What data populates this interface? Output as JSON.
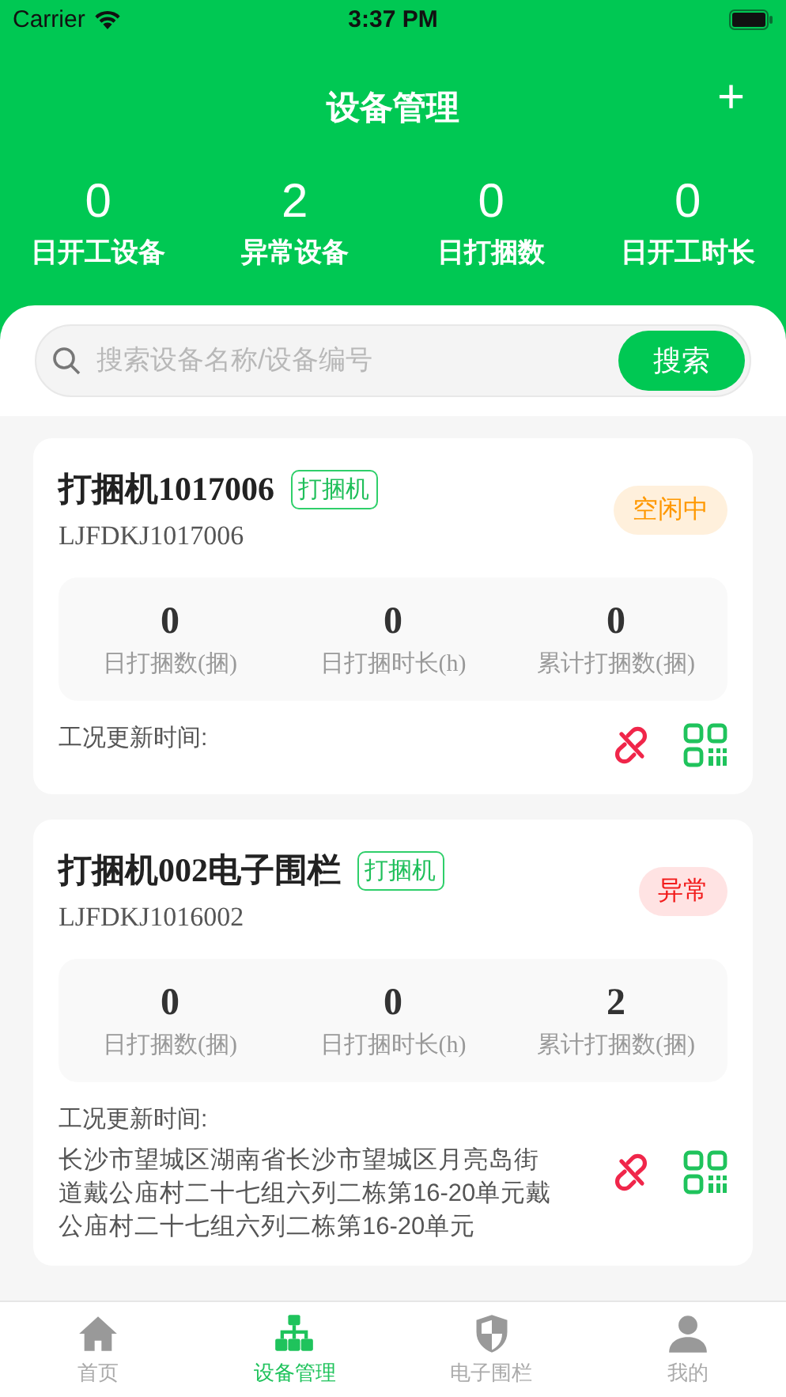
{
  "status_bar": {
    "carrier": "Carrier",
    "time": "3:37 PM"
  },
  "header": {
    "title": "设备管理",
    "add_label": "+"
  },
  "summary": [
    {
      "value": "0",
      "label": "日开工设备"
    },
    {
      "value": "2",
      "label": "异常设备"
    },
    {
      "value": "0",
      "label": "日打捆数"
    },
    {
      "value": "0",
      "label": "日开工时长"
    }
  ],
  "search": {
    "placeholder": "搜索设备名称/设备编号",
    "button": "搜索"
  },
  "devices": [
    {
      "name": "打捆机1017006",
      "tag": "打捆机",
      "code": "LJFDKJ1017006",
      "status": "空闲中",
      "kind": "idle",
      "stats": [
        {
          "value": "0",
          "label": "日打捆数(捆)"
        },
        {
          "value": "0",
          "label": "日打捆时长(h)"
        },
        {
          "value": "0",
          "label": "累计打捆数(捆)"
        }
      ],
      "update_label": "工况更新时间:"
    },
    {
      "name": "打捆机002电子围栏",
      "tag": "打捆机",
      "code": "LJFDKJ1016002",
      "status": "异常",
      "kind": "abnormal",
      "stats": [
        {
          "value": "0",
          "label": "日打捆数(捆)"
        },
        {
          "value": "0",
          "label": "日打捆时长(h)"
        },
        {
          "value": "2",
          "label": "累计打捆数(捆)"
        }
      ],
      "update_label": "工况更新时间:",
      "address": "长沙市望城区湖南省长沙市望城区月亮岛街道戴公庙村二十七组六列二栋第16-20单元戴公庙村二十七组六列二栋第16-20单元"
    }
  ],
  "tab_bar": [
    {
      "label": "首页",
      "kind": "home",
      "selected": false
    },
    {
      "label": "设备管理",
      "kind": "org",
      "selected": true
    },
    {
      "label": "电子围栏",
      "kind": "shield",
      "selected": false
    },
    {
      "label": "我的",
      "kind": "person",
      "selected": false
    }
  ]
}
